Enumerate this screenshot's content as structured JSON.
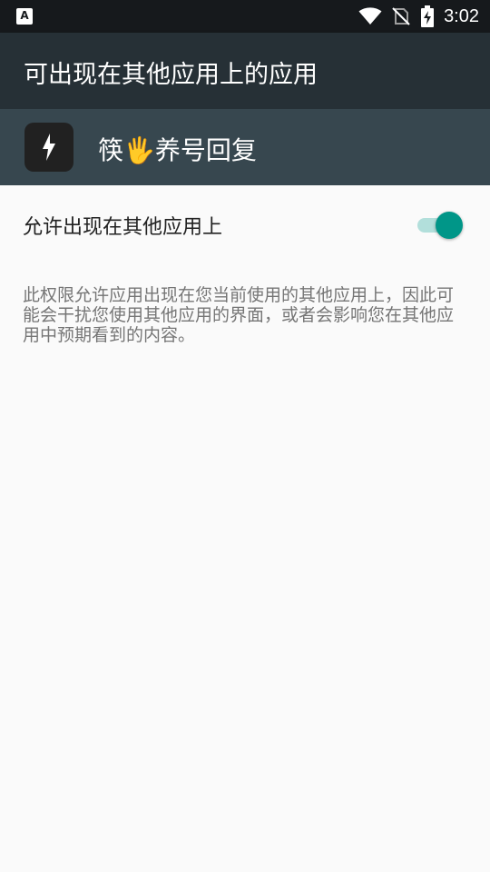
{
  "status_bar": {
    "left_icon": "text-a-icon",
    "left_icon_glyph": "A",
    "icons": [
      "wifi-icon",
      "no-sim-icon",
      "battery-charging-icon"
    ],
    "time": "3:02"
  },
  "app_bar": {
    "title": "可出现在其他应用上的应用"
  },
  "app_header": {
    "icon": "lightning-bolt-icon",
    "name": "筷🖐养号回复"
  },
  "setting": {
    "label": "允许出现在其他应用上",
    "switch_on": true,
    "accent_color": "#009688",
    "track_color": "#b2dfdb"
  },
  "description": "此权限允许应用出现在您当前使用的其他应用上，因此可能会干扰您使用其他应用的界面，或者会影响您在其他应用中预期看到的内容。"
}
